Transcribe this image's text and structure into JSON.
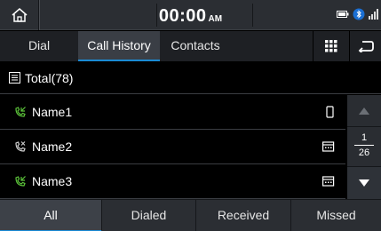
{
  "status": {
    "time": "00:00",
    "ampm": "AM"
  },
  "tabs": [
    {
      "label": "Dial"
    },
    {
      "label": "Call History"
    },
    {
      "label": "Contacts"
    }
  ],
  "total": {
    "label": "Total(78)"
  },
  "calls": [
    {
      "name": "Name1",
      "call_type": "received",
      "device": "mobile"
    },
    {
      "name": "Name2",
      "call_type": "missed",
      "device": "office"
    },
    {
      "name": "Name3",
      "call_type": "received",
      "device": "office"
    }
  ],
  "pager": {
    "current": "1",
    "total": "26"
  },
  "filters": [
    {
      "label": "All"
    },
    {
      "label": "Dialed"
    },
    {
      "label": "Received"
    },
    {
      "label": "Missed"
    }
  ],
  "colors": {
    "accent": "#1a8ad4",
    "received_call": "#5cc43a",
    "missed_call": "#d0d0d0"
  }
}
